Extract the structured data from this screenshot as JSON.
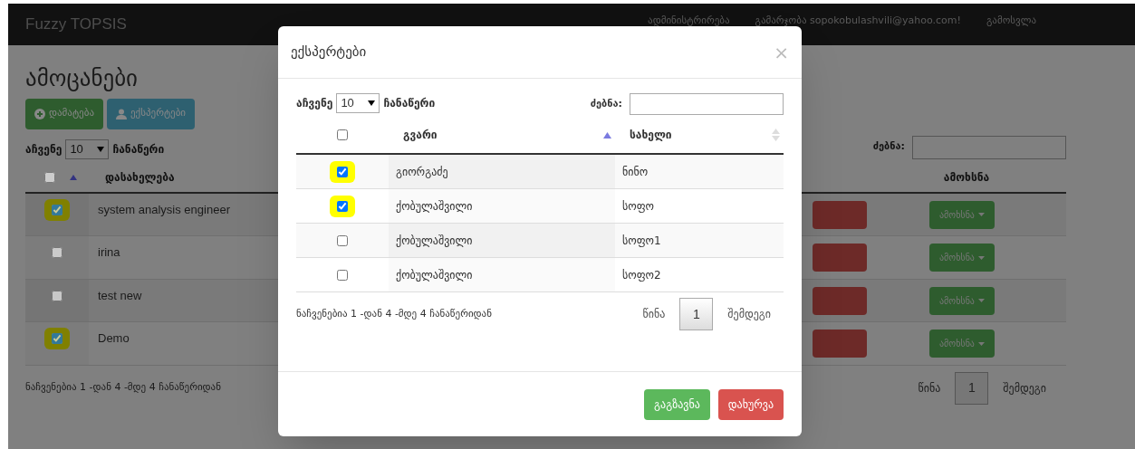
{
  "navbar": {
    "brand": "Fuzzy TOPSIS",
    "links": [
      "ადმინისტრირება",
      "გამარჯობა sopokobulashvili@yahoo.com!",
      "გამოსვლა"
    ]
  },
  "page": {
    "title": "ამოცანები",
    "buttons": [
      {
        "label": "დამატება",
        "kind": "add"
      },
      {
        "label": "ექსპერტები",
        "kind": "experts"
      }
    ],
    "length": {
      "prefix": "აჩვენე",
      "value": "10",
      "suffix": "ჩანაწერი"
    },
    "search_label": "ძებნა:",
    "table": {
      "select_all": {
        "checked": false
      },
      "columns": [
        "დასახელება",
        "ამოხსნა"
      ],
      "rows": [
        {
          "checked": true,
          "name": "system analysis engineer",
          "action": "ამოხსნა"
        },
        {
          "checked": false,
          "name": "irina",
          "action": "ამოხსნა"
        },
        {
          "checked": false,
          "name": "test new",
          "action": "ამოხსნა"
        },
        {
          "checked": true,
          "name": "Demo",
          "action": "ამოხსნა"
        }
      ]
    },
    "info": "ნაჩვენებია 1 -დან 4 -მდე 4 ჩანაწერიდან",
    "pagination": {
      "prev": "წინა",
      "page": "1",
      "next": "შემდეგი"
    }
  },
  "modal": {
    "title": "ექსპერტები",
    "close": "×",
    "length": {
      "prefix": "აჩვენე",
      "value": "10",
      "suffix": "ჩანაწერი"
    },
    "search_label": "ძებნა:",
    "table": {
      "select_all": {
        "checked": false
      },
      "columns": [
        "გვარი",
        "სახელი"
      ],
      "rows": [
        {
          "checked": true,
          "surname": "გიორგაძე",
          "name": "ნინო"
        },
        {
          "checked": true,
          "surname": "ქობულაშვილი",
          "name": "სოფო"
        },
        {
          "checked": false,
          "surname": "ქობულაშვილი",
          "name": "სოფო1"
        },
        {
          "checked": false,
          "surname": "ქობულაშვილი",
          "name": "სოფო2"
        }
      ]
    },
    "info": "ნაჩვენებია 1 -დან 4 -მდე 4 ჩანაწერიდან",
    "pagination": {
      "prev": "წინა",
      "page": "1",
      "next": "შემდეგი"
    },
    "buttons": [
      {
        "label": "გაგზავნა",
        "kind": "send"
      },
      {
        "label": "დახურვა",
        "kind": "close"
      }
    ]
  }
}
